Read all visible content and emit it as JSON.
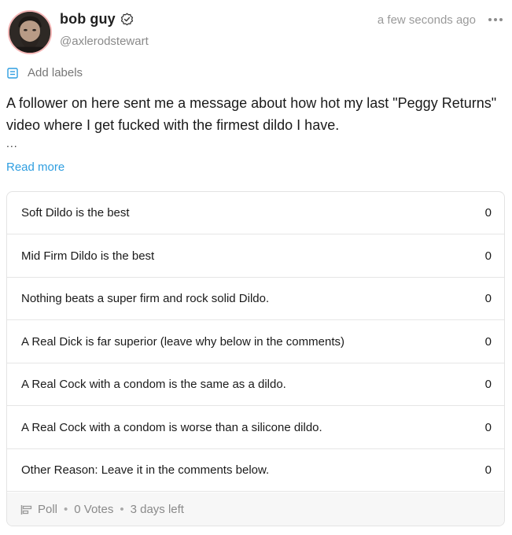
{
  "author": {
    "display_name": "bob guy",
    "handle": "@axlerodstewart"
  },
  "timestamp": "a few seconds ago",
  "labels": {
    "add_label": "Add labels"
  },
  "post": {
    "text": "A follower on here sent me a message about how hot my last \"Peggy Returns\" video where I get fucked with the firmest dildo I have.",
    "ellipsis": "...",
    "read_more": "Read more"
  },
  "poll": {
    "options": [
      {
        "label": "Soft Dildo is the best",
        "count": "0"
      },
      {
        "label": "Mid Firm Dildo is the best",
        "count": "0"
      },
      {
        "label": "Nothing beats a super firm and rock solid Dildo.",
        "count": "0"
      },
      {
        "label": "A Real Dick is far superior (leave why below in the comments)",
        "count": "0"
      },
      {
        "label": "A Real Cock with a condom is the same as a dildo.",
        "count": "0"
      },
      {
        "label": "A Real Cock with a condom is worse than a silicone dildo.",
        "count": "0"
      },
      {
        "label": "Other Reason: Leave it in the comments below.",
        "count": "0"
      }
    ],
    "footer": {
      "type_label": "Poll",
      "votes": "0 Votes",
      "time_left": "3 days left"
    }
  },
  "icons": {
    "verified": "verified-badge-icon",
    "more": "more-options-icon",
    "label": "label-icon",
    "poll": "poll-icon"
  },
  "colors": {
    "link": "#2f9ee0",
    "muted_text": "#8a8a8a",
    "avatar_ring": "#f2b4b4"
  }
}
